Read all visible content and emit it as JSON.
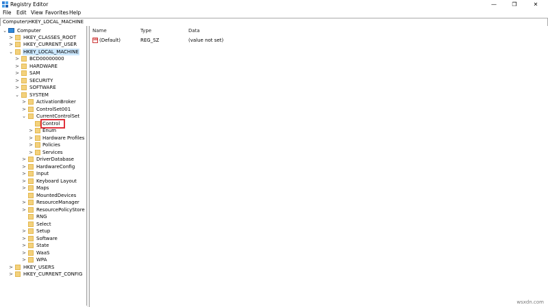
{
  "window": {
    "title": "Registry Editor",
    "app_icon": "registry-editor-icon",
    "controls": {
      "minimize": "—",
      "maximize": "❐",
      "close": "✕"
    }
  },
  "menu": {
    "file": "File",
    "edit": "Edit",
    "view": "View",
    "favorites": "Favorites",
    "help": "Help"
  },
  "address": {
    "path": "Computer\\HKEY_LOCAL_MACHINE"
  },
  "tree": {
    "root": "Computer",
    "hkcr": "HKEY_CLASSES_ROOT",
    "hkcu": "HKEY_CURRENT_USER",
    "hklm": "HKEY_LOCAL_MACHINE",
    "hklm_children": {
      "bcd": "BCD00000000",
      "hardware": "HARDWARE",
      "sam": "SAM",
      "security": "SECURITY",
      "software": "SOFTWARE",
      "system": "SYSTEM"
    },
    "system_children": {
      "activationbroker": "ActivationBroker",
      "controlset001": "ControlSet001",
      "currentcontrolset": "CurrentControlSet",
      "ccs_children": {
        "control": "Control",
        "enum": "Enum",
        "hardware_profiles": "Hardware Profiles",
        "policies": "Policies",
        "services": "Services"
      },
      "driverdatabase": "DriverDatabase",
      "hardwareconfig": "HardwareConfig",
      "input": "Input",
      "keyboard_layout": "Keyboard Layout",
      "maps": "Maps",
      "mounteddevices": "MountedDevices",
      "resourcemanager": "ResourceManager",
      "resourcepolicystore": "ResourcePolicyStore",
      "rng": "RNG",
      "select": "Select",
      "setup": "Setup",
      "software": "Software",
      "state": "State",
      "waas": "WaaS",
      "wpa": "WPA"
    },
    "hku": "HKEY_USERS",
    "hkcc": "HKEY_CURRENT_CONFIG",
    "expand_glyph": ">",
    "collapse_glyph": "⌄"
  },
  "list": {
    "columns": {
      "name": "Name",
      "type": "Type",
      "data": "Data"
    },
    "rows": [
      {
        "name": "(Default)",
        "type": "REG_SZ",
        "data": "(value not set)",
        "icon": "ab-icon"
      }
    ]
  },
  "icon_glyphs": {
    "ab": "ab"
  },
  "watermark": "wsxdn.com",
  "colors": {
    "selection": "#cce8ff",
    "highlight_box": "#e0303a",
    "folder": "#f3d17d"
  }
}
